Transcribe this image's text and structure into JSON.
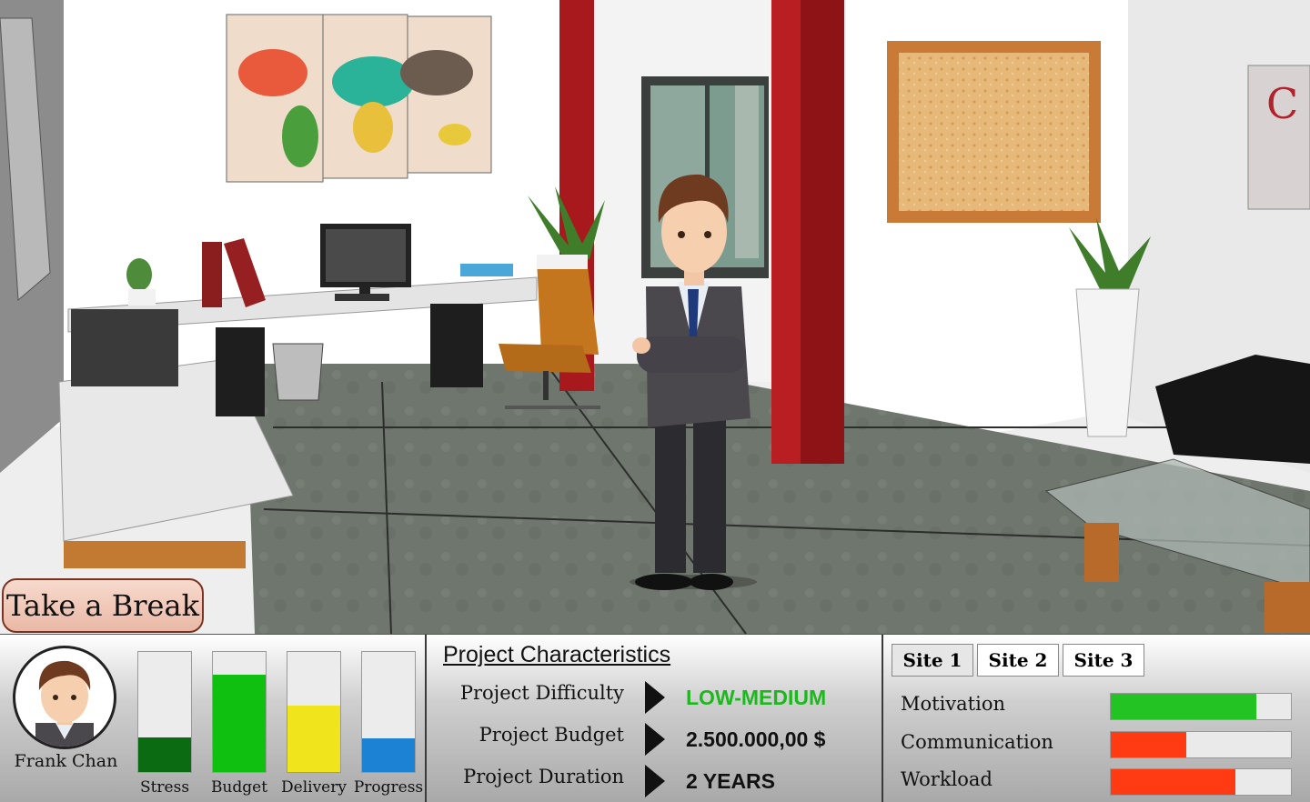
{
  "break_button": {
    "label": "Take a Break"
  },
  "player": {
    "name": "Frank Chan"
  },
  "colors": {
    "stress": "#0b6b12",
    "budget": "#10c010",
    "delivery": "#f0e51c",
    "progress": "#1c83d4",
    "good": "#22c322",
    "bad": "#ff3b14"
  },
  "meters": [
    {
      "label": "Stress",
      "level": 0.29,
      "color": "#0b6b12"
    },
    {
      "label": "Budget",
      "level": 0.81,
      "color": "#10c010"
    },
    {
      "label": "Delivery",
      "level": 0.55,
      "color": "#f0e51c"
    },
    {
      "label": "Progress",
      "level": 0.28,
      "color": "#1c83d4"
    }
  ],
  "project": {
    "title": "Project Characteristics",
    "rows": [
      {
        "label": "Project Difficulty",
        "value": "LOW-MEDIUM",
        "value_color": "#1db81d"
      },
      {
        "label": "Project Budget",
        "value": "2.500.000,00 $",
        "value_color": "#111111"
      },
      {
        "label": "Project Duration",
        "value": "2 YEARS",
        "value_color": "#111111"
      }
    ]
  },
  "sites": {
    "tabs": [
      "Site 1",
      "Site 2",
      "Site 3"
    ],
    "active": 0,
    "metrics": [
      {
        "label": "Motivation",
        "level": 0.81,
        "color": "#22c322"
      },
      {
        "label": "Communication",
        "level": 0.42,
        "color": "#ff3b14"
      },
      {
        "label": "Workload",
        "level": 0.69,
        "color": "#ff3b14"
      }
    ]
  }
}
